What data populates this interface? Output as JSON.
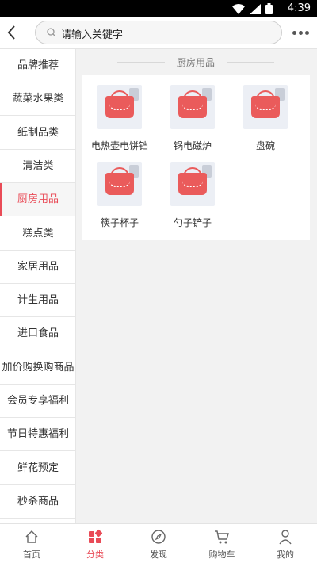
{
  "status": {
    "time": "4:39"
  },
  "search": {
    "placeholder": "请输入关键字"
  },
  "sidebar": {
    "items": [
      {
        "label": "品牌推荐"
      },
      {
        "label": "蔬菜水果类"
      },
      {
        "label": "纸制品类"
      },
      {
        "label": "清洁类"
      },
      {
        "label": "厨房用品"
      },
      {
        "label": "糕点类"
      },
      {
        "label": "家居用品"
      },
      {
        "label": "计生用品"
      },
      {
        "label": "进口食品"
      },
      {
        "label": "加价购换购商品"
      },
      {
        "label": "会员专享福利"
      },
      {
        "label": "节日特惠福利"
      },
      {
        "label": "鲜花预定"
      },
      {
        "label": "秒杀商品"
      }
    ],
    "active_label": "厨房用品"
  },
  "section": {
    "title": "厨房用品"
  },
  "products": [
    {
      "name": "电热壶电饼铛"
    },
    {
      "name": "锅电磁炉"
    },
    {
      "name": "盘碗"
    },
    {
      "name": "筷子杯子"
    },
    {
      "name": "勺子铲子"
    }
  ],
  "tabbar": {
    "items": [
      {
        "label": "首页",
        "icon": "home-icon"
      },
      {
        "label": "分类",
        "icon": "category-icon"
      },
      {
        "label": "发现",
        "icon": "compass-icon"
      },
      {
        "label": "购物车",
        "icon": "cart-icon"
      },
      {
        "label": "我的",
        "icon": "user-icon"
      }
    ],
    "active_label": "分类"
  },
  "colors": {
    "accent": "#e94b57",
    "status_bar": "#000000"
  }
}
